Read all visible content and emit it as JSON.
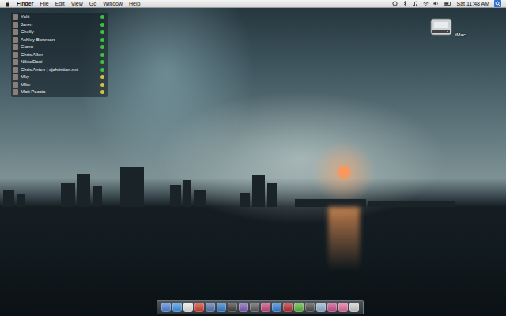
{
  "menu_bar": {
    "app": "Finder",
    "menus": [
      "File",
      "Edit",
      "View",
      "Go",
      "Window",
      "Help"
    ],
    "clock": "Sat 11:48 AM"
  },
  "contacts": [
    {
      "name": "Yaki",
      "color": "#3cc23c"
    },
    {
      "name": "Jaren",
      "color": "#3cc23c"
    },
    {
      "name": "Chelly",
      "color": "#3cc23c"
    },
    {
      "name": "Ashley Bowman",
      "color": "#3cc23c"
    },
    {
      "name": "Giann",
      "color": "#3cc23c"
    },
    {
      "name": "Chris Allen",
      "color": "#3cc23c"
    },
    {
      "name": "NikkoDani",
      "color": "#3cc23c"
    },
    {
      "name": "Chris Anton | djchristian.net",
      "color": "#3cc23c"
    },
    {
      "name": "Mky",
      "color": "#d9c23a"
    },
    {
      "name": "Mike",
      "color": "#d9c23a"
    },
    {
      "name": "Matt Poccia",
      "color": "#d9c23a"
    }
  ],
  "desktop_icons": [
    {
      "label": "iMac"
    }
  ],
  "dock": {
    "items": [
      {
        "color": "#4a7fd6"
      },
      {
        "color": "#3a8fe0"
      },
      {
        "color": "#e8e8e8"
      },
      {
        "color": "#d23a2a"
      },
      {
        "color": "#4f6fa8"
      },
      {
        "color": "#2d78c8"
      },
      {
        "color": "#3a3a3a"
      },
      {
        "color": "#7a5ab0"
      },
      {
        "color": "#555555"
      },
      {
        "color": "#c2447a"
      },
      {
        "color": "#2e7bd1"
      },
      {
        "color": "#b0262e"
      },
      {
        "color": "#58b03a"
      },
      {
        "color": "#444444"
      },
      {
        "color": "#8fb0d0"
      },
      {
        "color": "#c84a8a"
      },
      {
        "color": "#e06a9a"
      },
      {
        "color": "#cfcfcf"
      }
    ]
  }
}
